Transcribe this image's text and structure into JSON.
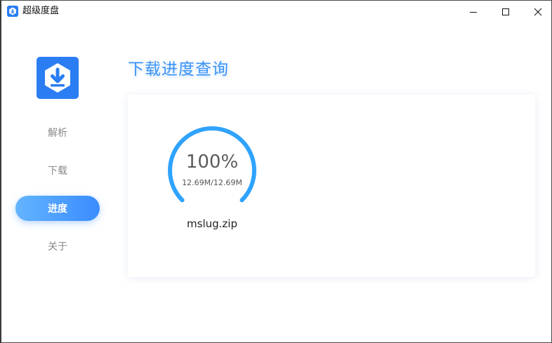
{
  "window": {
    "title": "超级度盘",
    "controls": {
      "minimize_icon": "minimize-icon",
      "maximize_icon": "maximize-icon",
      "close_icon": "close-icon"
    }
  },
  "sidebar": {
    "logo_icon": "download-box-icon",
    "items": [
      {
        "label": "解析",
        "active": false
      },
      {
        "label": "下载",
        "active": false
      },
      {
        "label": "进度",
        "active": true
      },
      {
        "label": "关于",
        "active": false
      }
    ]
  },
  "main": {
    "title": "下载进度查询",
    "tasks": [
      {
        "percent_label": "100%",
        "progress": 1.0,
        "size_label": "12.69M/12.69M",
        "file_name": "mslug.zip"
      }
    ]
  },
  "colors": {
    "accent": "#2a7df3",
    "ring": "#2fa3ff",
    "title": "#3d94f6"
  }
}
